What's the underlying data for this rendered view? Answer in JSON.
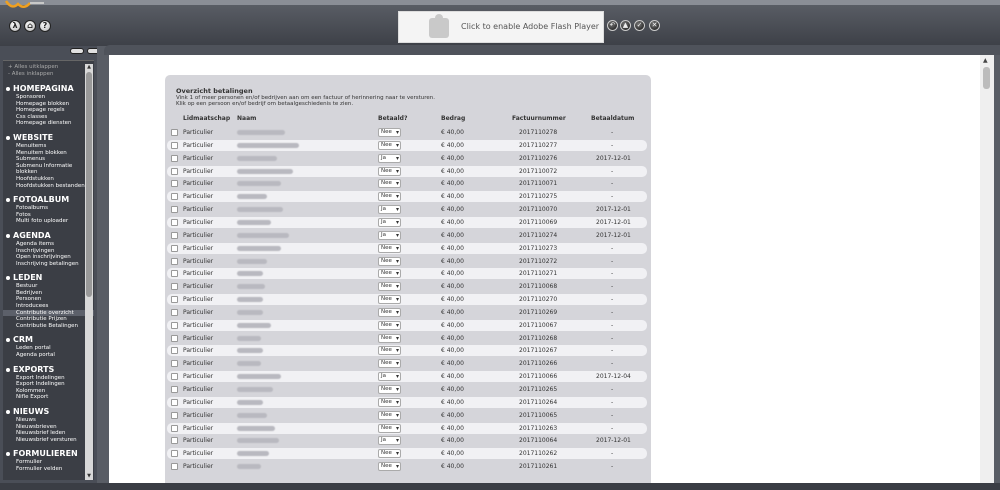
{
  "header": {
    "flash_message": "Click to enable Adobe Flash Player",
    "left_buttons": [
      "λ",
      "⌂",
      "?"
    ]
  },
  "sidebar": {
    "expand_all": "+ Alles uitklappen",
    "collapse_all": "- Alles inklappen",
    "sections": [
      {
        "title": "HOMEPAGINA",
        "items": [
          "Sponsoren",
          "Homepage blokken",
          "Homepage regels",
          "Css classes",
          "Homepage diensten"
        ]
      },
      {
        "title": "WEBSITE",
        "items": [
          "Menuitems",
          "Menuitem blokken",
          "Submenus",
          "Submenu Informatie",
          "blokken",
          "Hoofdstukken",
          "Hoofdstukken bestanden"
        ]
      },
      {
        "title": "FOTOALBUM",
        "items": [
          "Fotoalbums",
          "Fotos",
          "Multi foto uploader"
        ]
      },
      {
        "title": "AGENDA",
        "items": [
          "Agenda items",
          "Inschrijvingen",
          "Open inschrijvingen",
          "Inschrijving betalingen"
        ]
      },
      {
        "title": "LEDEN",
        "items": [
          "Bestuur",
          "Bedrijven",
          "Personen",
          "Introducees",
          "Contributie overzicht",
          "Contributie Prijzen",
          "Contributie Betalingen"
        ],
        "active": 4
      },
      {
        "title": "CRM",
        "items": [
          "Leden portal",
          "Agenda portal"
        ]
      },
      {
        "title": "EXPORTS",
        "items": [
          "Export Indelingen",
          "Export Indelingen",
          "Kolommen",
          "Nifle Export"
        ]
      },
      {
        "title": "NIEUWS",
        "items": [
          "Nieuws",
          "Nieuwsbrieven",
          "Nieuwsbrief leden",
          "Nieuwsbrief versturen"
        ]
      },
      {
        "title": "FORMULIEREN",
        "items": [
          "Formulier",
          "Formulier velden"
        ]
      }
    ]
  },
  "content": {
    "title": "Overzicht betalingen",
    "desc_line1": "Vink 1 of meer personen en/of bedrijven aan om een factuur of herinnering naar te versturen.",
    "desc_line2": "Klik op een persoon en/of bedrijf om betaalgeschiedenis te zien.",
    "columns": {
      "lidmaatschap": "Lidmaatschap",
      "naam": "Naam",
      "betaald": "Betaald?",
      "bedrag": "Bedrag",
      "factuurnummer": "Factuurnummer",
      "betaaldatum": "Betaaldatum"
    },
    "rows": [
      {
        "type": "Particulier",
        "betaald": "Nee",
        "bedrag": "€ 40,00",
        "factuur": "2017110278",
        "datum": "-"
      },
      {
        "type": "Particulier",
        "betaald": "Nee",
        "bedrag": "€ 40,00",
        "factuur": "2017110277",
        "datum": "-"
      },
      {
        "type": "Particulier",
        "betaald": "Ja",
        "bedrag": "€ 40,00",
        "factuur": "2017110276",
        "datum": "2017-12-01"
      },
      {
        "type": "Particulier",
        "betaald": "Nee",
        "bedrag": "€ 40,00",
        "factuur": "2017110072",
        "datum": "-"
      },
      {
        "type": "Particulier",
        "betaald": "Nee",
        "bedrag": "€ 40,00",
        "factuur": "2017110071",
        "datum": "-"
      },
      {
        "type": "Particulier",
        "betaald": "Nee",
        "bedrag": "€ 40,00",
        "factuur": "2017110275",
        "datum": "-"
      },
      {
        "type": "Particulier",
        "betaald": "Ja",
        "bedrag": "€ 40,00",
        "factuur": "2017110070",
        "datum": "2017-12-01"
      },
      {
        "type": "Particulier",
        "betaald": "Ja",
        "bedrag": "€ 40,00",
        "factuur": "2017110069",
        "datum": "2017-12-01"
      },
      {
        "type": "Particulier",
        "betaald": "Ja",
        "bedrag": "€ 40,00",
        "factuur": "2017110274",
        "datum": "2017-12-01"
      },
      {
        "type": "Particulier",
        "betaald": "Nee",
        "bedrag": "€ 40,00",
        "factuur": "2017110273",
        "datum": "-"
      },
      {
        "type": "Particulier",
        "betaald": "Nee",
        "bedrag": "€ 40,00",
        "factuur": "2017110272",
        "datum": "-"
      },
      {
        "type": "Particulier",
        "betaald": "Nee",
        "bedrag": "€ 40,00",
        "factuur": "2017110271",
        "datum": "-"
      },
      {
        "type": "Particulier",
        "betaald": "Nee",
        "bedrag": "€ 40,00",
        "factuur": "2017110068",
        "datum": "-"
      },
      {
        "type": "Particulier",
        "betaald": "Nee",
        "bedrag": "€ 40,00",
        "factuur": "2017110270",
        "datum": "-"
      },
      {
        "type": "Particulier",
        "betaald": "Nee",
        "bedrag": "€ 40,00",
        "factuur": "2017110269",
        "datum": "-"
      },
      {
        "type": "Particulier",
        "betaald": "Nee",
        "bedrag": "€ 40,00",
        "factuur": "2017110067",
        "datum": "-"
      },
      {
        "type": "Particulier",
        "betaald": "Nee",
        "bedrag": "€ 40,00",
        "factuur": "2017110268",
        "datum": "-"
      },
      {
        "type": "Particulier",
        "betaald": "Nee",
        "bedrag": "€ 40,00",
        "factuur": "2017110267",
        "datum": "-"
      },
      {
        "type": "Particulier",
        "betaald": "Nee",
        "bedrag": "€ 40,00",
        "factuur": "2017110266",
        "datum": "-"
      },
      {
        "type": "Particulier",
        "betaald": "Ja",
        "bedrag": "€ 40,00",
        "factuur": "2017110066",
        "datum": "2017-12-04"
      },
      {
        "type": "Particulier",
        "betaald": "Nee",
        "bedrag": "€ 40,00",
        "factuur": "2017110265",
        "datum": "-"
      },
      {
        "type": "Particulier",
        "betaald": "Nee",
        "bedrag": "€ 40,00",
        "factuur": "2017110264",
        "datum": "-"
      },
      {
        "type": "Particulier",
        "betaald": "Nee",
        "bedrag": "€ 40,00",
        "factuur": "2017110065",
        "datum": "-"
      },
      {
        "type": "Particulier",
        "betaald": "Nee",
        "bedrag": "€ 40,00",
        "factuur": "2017110263",
        "datum": "-"
      },
      {
        "type": "Particulier",
        "betaald": "Ja",
        "bedrag": "€ 40,00",
        "factuur": "2017110064",
        "datum": "2017-12-01"
      },
      {
        "type": "Particulier",
        "betaald": "Nee",
        "bedrag": "€ 40,00",
        "factuur": "2017110262",
        "datum": "-"
      },
      {
        "type": "Particulier",
        "betaald": "Nee",
        "bedrag": "€ 40,00",
        "factuur": "2017110261",
        "datum": "-"
      }
    ]
  }
}
